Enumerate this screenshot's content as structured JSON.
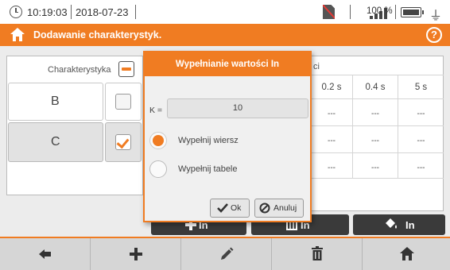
{
  "status_bar": {
    "time": "10:19:03",
    "date": "2018-07-23",
    "battery_percent": "100 %",
    "battery_level": 1.0,
    "icons": [
      "clock-icon",
      "sim-missing-icon",
      "signal-icon",
      "battery-icon",
      "plug-icon"
    ]
  },
  "title_bar": {
    "title": "Dodawanie charakterystyk.",
    "help_symbol": "?"
  },
  "table": {
    "header_label": "Charakterystyka",
    "header_fragment": "ci",
    "column_headers": [
      "0.2 s",
      "0.4 s",
      "5 s"
    ],
    "rows": [
      {
        "label": "B",
        "checked": false,
        "values": [
          "---",
          "---",
          "---"
        ]
      },
      {
        "label": "C",
        "checked": true,
        "values": [
          "---",
          "---",
          "---"
        ]
      }
    ],
    "extra_row": [
      "---",
      "---",
      "---"
    ]
  },
  "action_buttons": {
    "add_in_label": "In",
    "table_in_label": "In",
    "fill_in_label": "In"
  },
  "dialog": {
    "title": "Wypełnianie wartości In",
    "k_label": "K =",
    "k_value": "10",
    "options": [
      {
        "label": "Wypełnij wiersz",
        "selected": true
      },
      {
        "label": "Wypełnij tabele",
        "selected": false
      }
    ],
    "ok_label": "Ok",
    "cancel_label": "Anuluj"
  },
  "toolbar": {
    "buttons": [
      "back-arrow-icon",
      "add-plus-icon",
      "edit-pencil-icon",
      "delete-trash-icon",
      "home-icon"
    ]
  },
  "colors": {
    "accent": "#f07c22",
    "dark_button": "#3a3a3a",
    "toolbar_bg": "#d6d6d6"
  }
}
